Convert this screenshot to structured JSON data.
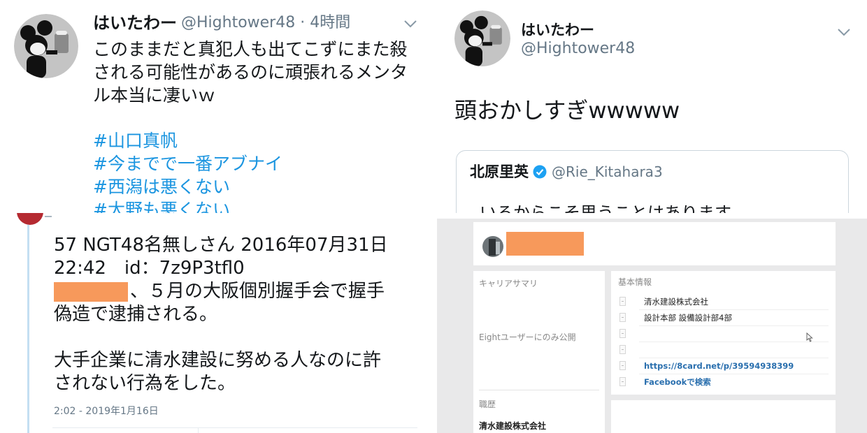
{
  "tweet_list": {
    "name": "はいたわー",
    "handle_time": "@Hightower48 · 4時間",
    "lines": [
      "このままだと真犯人も出てこずにまた殺",
      "される可能性があるのに頑張れるメンタ",
      "ル本当に凄いｗ"
    ],
    "hashtags": [
      "#山口真帆",
      "#今までで一番アブナイ",
      "#西潟は悪くない",
      "#太野も悪くない"
    ]
  },
  "tweet_detail": {
    "name": "はいたわー",
    "handle": "@Hightower48",
    "text": "頭おかしすぎwwwww",
    "quote": {
      "name": "北原里英",
      "handle": "@Rie_Kitahara3",
      "text": "いるからこそ思うことはあります"
    }
  },
  "thread_tweet": {
    "line1": "57 NGT48名無しさん 2016年07月31日",
    "line2": "22:42　id：7z9P3tfl0",
    "line3": "、５月の大阪個別握手会で握手",
    "line4": "偽造で逮捕される。",
    "line5": "大手企業に清水建設に努める人なのに許",
    "line6": "されない行為をした。",
    "timestamp": "2:02 - 2019年1月16日"
  },
  "eight_profile": {
    "career_summary": {
      "title": "キャリアサマリ",
      "note": "Eightユーザーにのみ公開"
    },
    "history": {
      "title": "職歴",
      "company": "清水建設株式会社"
    },
    "basic_info": {
      "title": "基本情報",
      "rows": [
        "清水建設株式会社",
        "設計本部 設備設計部4部",
        "",
        "",
        "https://8card.net/p/39594938399",
        "Facebookで検索"
      ]
    }
  },
  "colors": {
    "twitter_blue": "#1b95e0",
    "twitter_gray": "#657786",
    "twitter_text": "#14171a",
    "redaction_orange": "#f7995b",
    "thread_line": "#c4dff2",
    "link_blue": "#2a6fae",
    "eight_bg": "#e9e9ea"
  }
}
